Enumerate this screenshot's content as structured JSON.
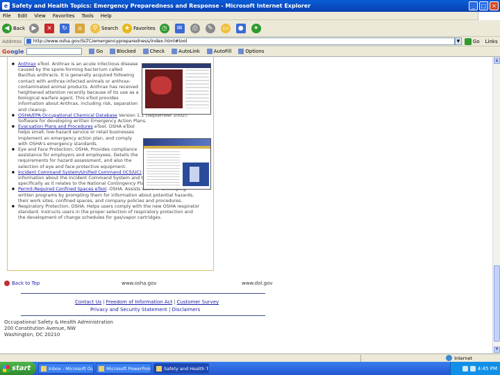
{
  "window": {
    "title": "Safety and Health Topics: Emergency Preparedness and Response - Microsoft Internet Explorer",
    "minimize": "_",
    "maximize": "□",
    "close": "×"
  },
  "menu": [
    "File",
    "Edit",
    "View",
    "Favorites",
    "Tools",
    "Help"
  ],
  "toolbar": {
    "back": "Back",
    "search": "Search",
    "favorites": "Favorites"
  },
  "address": {
    "label": "Address",
    "url": "http://www.osha.gov/SLTC/emergencypreparedness/index.html#tool",
    "go": "Go",
    "links": "Links"
  },
  "google": {
    "logo_g": "Go",
    "logo_rest": "ogle",
    "items": [
      "Go",
      "Blocked",
      "Check",
      "AutoLink",
      "AutoFill",
      "Options"
    ]
  },
  "content": {
    "resources": [
      {
        "link": "Anthrax",
        "text": " eTool. Anthrax is an acute infectious disease caused by the spore-forming bacterium called Bacillus anthracis. It is generally acquired following contact with anthrax-infected animals or anthrax-contaminated animal products. Anthrax has received heightened attention recently because of its use as a biological warfare agent. This eTool provides information about Anthrax, including risk, separation and cleanup.",
        "narrow": true
      },
      {
        "link": "OSHA/EPA Occupational Chemical Database",
        "text": " Version 1.1 (September 2002). Software for developing written Emergency Action Plans.",
        "narrow": false
      },
      {
        "link": "Evacuation Plans and Procedures",
        "text": " eTool. OSHA eTool helps small, low-hazard service or retail businesses implement an emergency action plan, and comply with OSHA's emergency standards.",
        "narrow": true
      },
      {
        "link": "",
        "text": "Eye and Face Protection. OSHA. Provides compliance assistance for employers and employees. Details the requirements for hazard assessment, and also the selection of eye and face protective equipment.",
        "narrow": true
      },
      {
        "link": "Incident Command System/Unified Command (ICS/UC)",
        "text": ". OSHA. Provides basic information about the Incident Command System and the Unified Command, specifically as it relates to the National Contingency Plan (NCP).",
        "narrow": false
      },
      {
        "link": "Permit-Required Confined Spaces eTool",
        "text": ". OSHA. Assists users in developing written programs by prompting them for information about potential hazards, their work sites, confined spaces, and company policies and procedures.",
        "narrow": false
      },
      {
        "link": "",
        "text": "Respiratory Protection. OSHA. Helps users comply with the new OSHA respirator standard. Instructs users in the proper selection of respiratory protection and the development of change schedules for gas/vapor cartridges.",
        "narrow": false
      }
    ]
  },
  "footer": {
    "back_to_top": "Back to Top",
    "url_left": "www.osha.gov",
    "url_right": "www.dol.gov",
    "links": [
      "Contact Us",
      "Freedom of Information Act",
      "Customer Survey"
    ],
    "links2": "Privacy and Security Statement | Disclaimers",
    "address_lines": [
      "Occupational Safety & Health Administration",
      "200 Constitution Avenue, NW",
      "Washington, DC 20210"
    ]
  },
  "status": {
    "zone": "Internet"
  },
  "taskbar": {
    "start": "start",
    "tasks": [
      {
        "label": "Inbox - Microsoft Out...",
        "active": false
      },
      {
        "label": "Microsoft PowerPoint...",
        "active": false
      },
      {
        "label": "Safety and Health To...",
        "active": true
      }
    ],
    "clock": "4:45 PM"
  }
}
